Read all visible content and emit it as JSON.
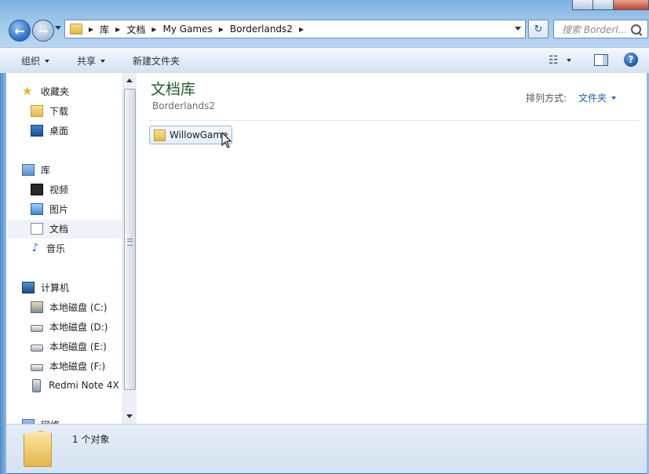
{
  "window": {
    "back_icon": "back-arrow-icon",
    "forward_icon": "forward-arrow-icon"
  },
  "address": {
    "crumbs": [
      "库",
      "文档",
      "My Games",
      "Borderlands2"
    ],
    "refresh_icon": "refresh-icon"
  },
  "search": {
    "placeholder": "搜索 Borderl..."
  },
  "toolbar": {
    "organize": "组织",
    "share": "共享",
    "new_folder": "新建文件夹",
    "view_icon": "view-options-icon",
    "pane_icon": "preview-pane-icon",
    "help_icon": "help-icon",
    "help_glyph": "?"
  },
  "sidebar": {
    "favorites": {
      "label": "收藏夹",
      "items": [
        "下载",
        "桌面"
      ]
    },
    "libraries": {
      "label": "库",
      "items": [
        "视频",
        "图片",
        "文档",
        "音乐"
      ],
      "selected": "文档"
    },
    "computer": {
      "label": "计算机",
      "items": [
        "本地磁盘 (C:)",
        "本地磁盘 (D:)",
        "本地磁盘 (E:)",
        "本地磁盘 (F:)",
        "Redmi Note 4X"
      ]
    },
    "network": {
      "label": "网络"
    }
  },
  "content": {
    "title": "文档库",
    "subtitle": "Borderlands2",
    "arrange_label": "排列方式:",
    "arrange_value": "文件夹",
    "items": [
      {
        "name": "WillowGame",
        "icon": "folder-icon"
      }
    ]
  },
  "status": {
    "text": "1 个对象"
  },
  "colors": {
    "library_title": "#1e5c2e",
    "link_blue": "#1c5fb3",
    "chrome_blue": "#2a6fb6"
  }
}
